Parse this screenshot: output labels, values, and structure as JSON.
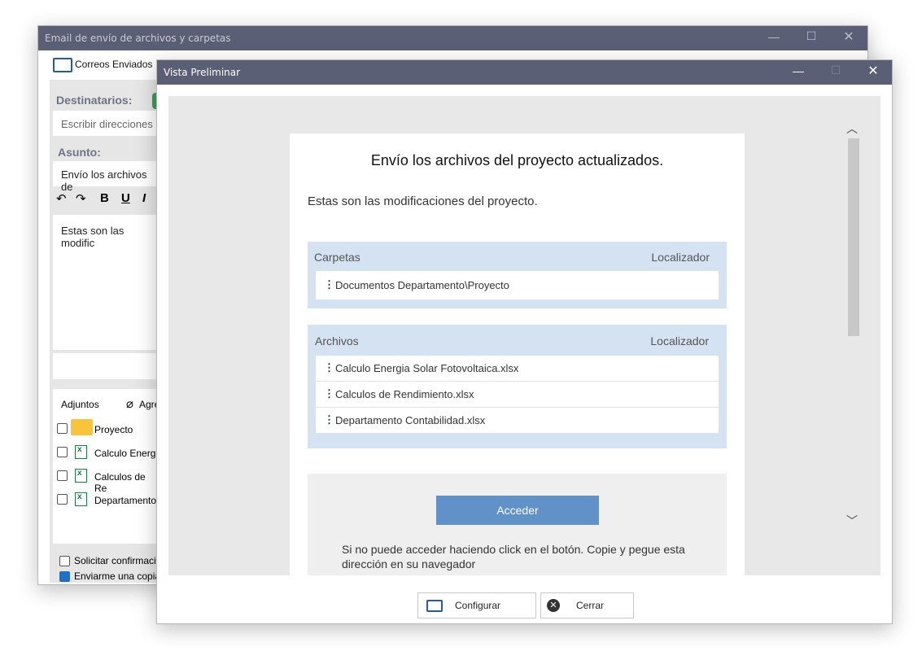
{
  "back_window": {
    "title": "Email de envío de archivos y carpetas",
    "toolbar_item": "Correos Enviados",
    "recipients_label": "Destinatarios:",
    "recipients_placeholder": "Escribir direcciones",
    "subject_label": "Asunto:",
    "subject_value": "Envío los archivos de",
    "body_text": "Estas son las modific",
    "attachments_label": "Adjuntos",
    "add_label": "Agre",
    "attachments": [
      "Proyecto",
      "Calculo Energi",
      "Calculos de Re",
      "Departamento"
    ],
    "option_confirm": "Solicitar confirmació",
    "option_copy": "Enviarme una copia"
  },
  "preview": {
    "title": "Vista Preliminar",
    "heading": "Envío los archivos del proyecto actualizados.",
    "intro": "Estas son las modificaciones del proyecto.",
    "folders": {
      "header": "Carpetas",
      "locator": "Localizador",
      "items": [
        "Documentos Departamento\\Proyecto"
      ]
    },
    "files": {
      "header": "Archivos",
      "locator": "Localizador",
      "items": [
        "Calculo Energia Solar Fotovoltaica.xlsx",
        "Calculos de Rendimiento.xlsx",
        "Departamento Contabilidad.xlsx"
      ]
    },
    "access_button": "Acceder",
    "footer_note": "Si no puede acceder haciendo click en el botón. Copie y pegue esta dirección en su navegador",
    "configure_button": "Configurar",
    "close_button": "Cerrar"
  },
  "colors": {
    "titlebar": "#5a5f76",
    "table_bg": "#d4e2f1",
    "access_button": "#6092c7"
  }
}
